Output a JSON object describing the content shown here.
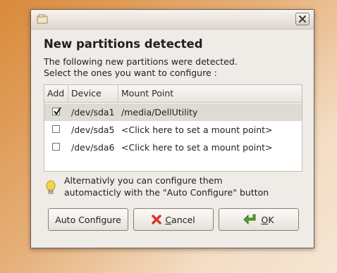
{
  "dialog": {
    "heading": "New partitions detected",
    "description_line1": "The following new partitions were detected.",
    "description_line2": "Select the ones you want to configure :"
  },
  "table": {
    "columns": [
      "Add",
      "Device",
      "Mount Point"
    ],
    "rows": [
      {
        "checked": true,
        "device": "/dev/sda1",
        "mount_point": "/media/DellUtility"
      },
      {
        "checked": false,
        "device": "/dev/sda5",
        "mount_point": "<Click here to set a mount point>"
      },
      {
        "checked": false,
        "device": "/dev/sda6",
        "mount_point": "<Click here to set a mount point>"
      }
    ]
  },
  "hint": {
    "line1": "Alternativly you can configure them",
    "line2": "automacticly with the \"Auto Configure\" button"
  },
  "buttons": {
    "auto_configure": "Auto Configure",
    "cancel_mnemonic": "C",
    "cancel_rest": "ancel",
    "ok_mnemonic": "O",
    "ok_rest": "K"
  },
  "icons": {
    "title": "window-icon",
    "close": "close-icon",
    "hint": "lightbulb-icon",
    "cancel": "red-x-icon",
    "ok": "green-arrow-icon"
  },
  "colors": {
    "cancel_icon": "#d23c2f",
    "ok_icon": "#5aa02c",
    "bulb": "#f4d64a"
  }
}
